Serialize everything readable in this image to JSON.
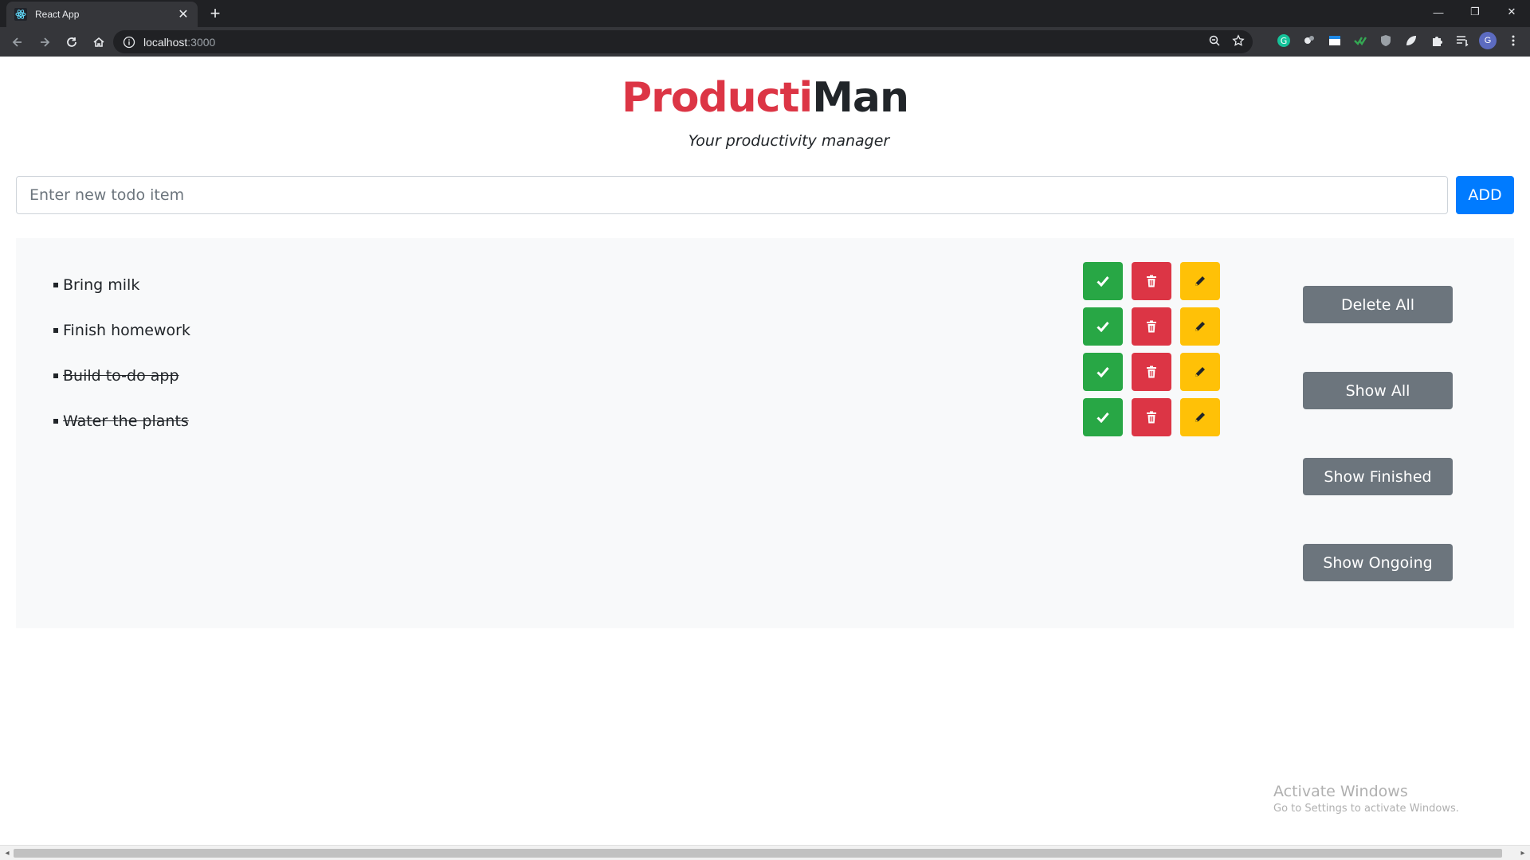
{
  "browser": {
    "tab_title": "React App",
    "url_host": "localhost",
    "url_port": ":3000",
    "profile_initial": "G"
  },
  "app": {
    "brand_part1": "Producti",
    "brand_part2": "Man",
    "tagline": "Your productivity manager",
    "input_placeholder": "Enter new todo item",
    "add_label": "ADD",
    "todos": [
      {
        "text": "Bring milk",
        "done": false
      },
      {
        "text": "Finish homework",
        "done": false
      },
      {
        "text": "Build to-do app",
        "done": true
      },
      {
        "text": "Water the plants",
        "done": true
      }
    ],
    "side_buttons": [
      "Delete All",
      "Show All",
      "Show Finished",
      "Show Ongoing"
    ]
  },
  "os": {
    "activate_title": "Activate Windows",
    "activate_sub": "Go to Settings to activate Windows."
  },
  "colors": {
    "brand_red": "#dc3545",
    "primary": "#007bff",
    "success": "#28a745",
    "danger": "#dc3545",
    "warning": "#ffc107",
    "secondary": "#6c757d"
  }
}
